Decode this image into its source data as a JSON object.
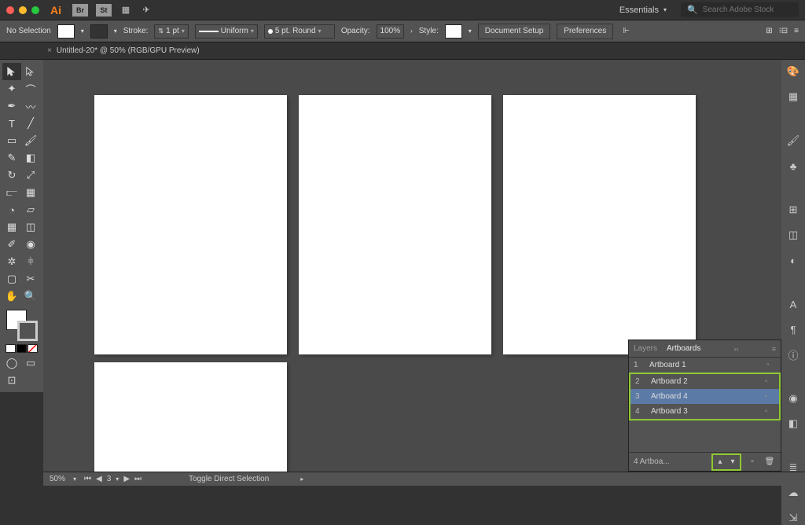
{
  "top": {
    "workspace": "Essentials",
    "search_placeholder": "Search Adobe Stock",
    "br": "Br",
    "st": "St"
  },
  "control": {
    "selection": "No Selection",
    "stroke_label": "Stroke:",
    "stroke_weight": "1 pt",
    "stroke_profile": "Uniform",
    "stroke_cap": "5 pt. Round",
    "opacity_label": "Opacity:",
    "opacity": "100%",
    "style_label": "Style:",
    "doc_setup": "Document Setup",
    "prefs": "Preferences"
  },
  "tab": {
    "close": "×",
    "title": "Untitled-20* @ 50% (RGB/GPU Preview)"
  },
  "panel": {
    "tab_layers": "Layers",
    "tab_artboards": "Artboards",
    "rows": [
      {
        "n": "1",
        "name": "Artboard 1"
      },
      {
        "n": "2",
        "name": "Artboard 2"
      },
      {
        "n": "3",
        "name": "Artboard 4"
      },
      {
        "n": "4",
        "name": "Artboard 3"
      }
    ],
    "footer_count": "4 Artboa..."
  },
  "status": {
    "zoom": "50%",
    "page": "3",
    "hint": "Toggle Direct Selection"
  }
}
